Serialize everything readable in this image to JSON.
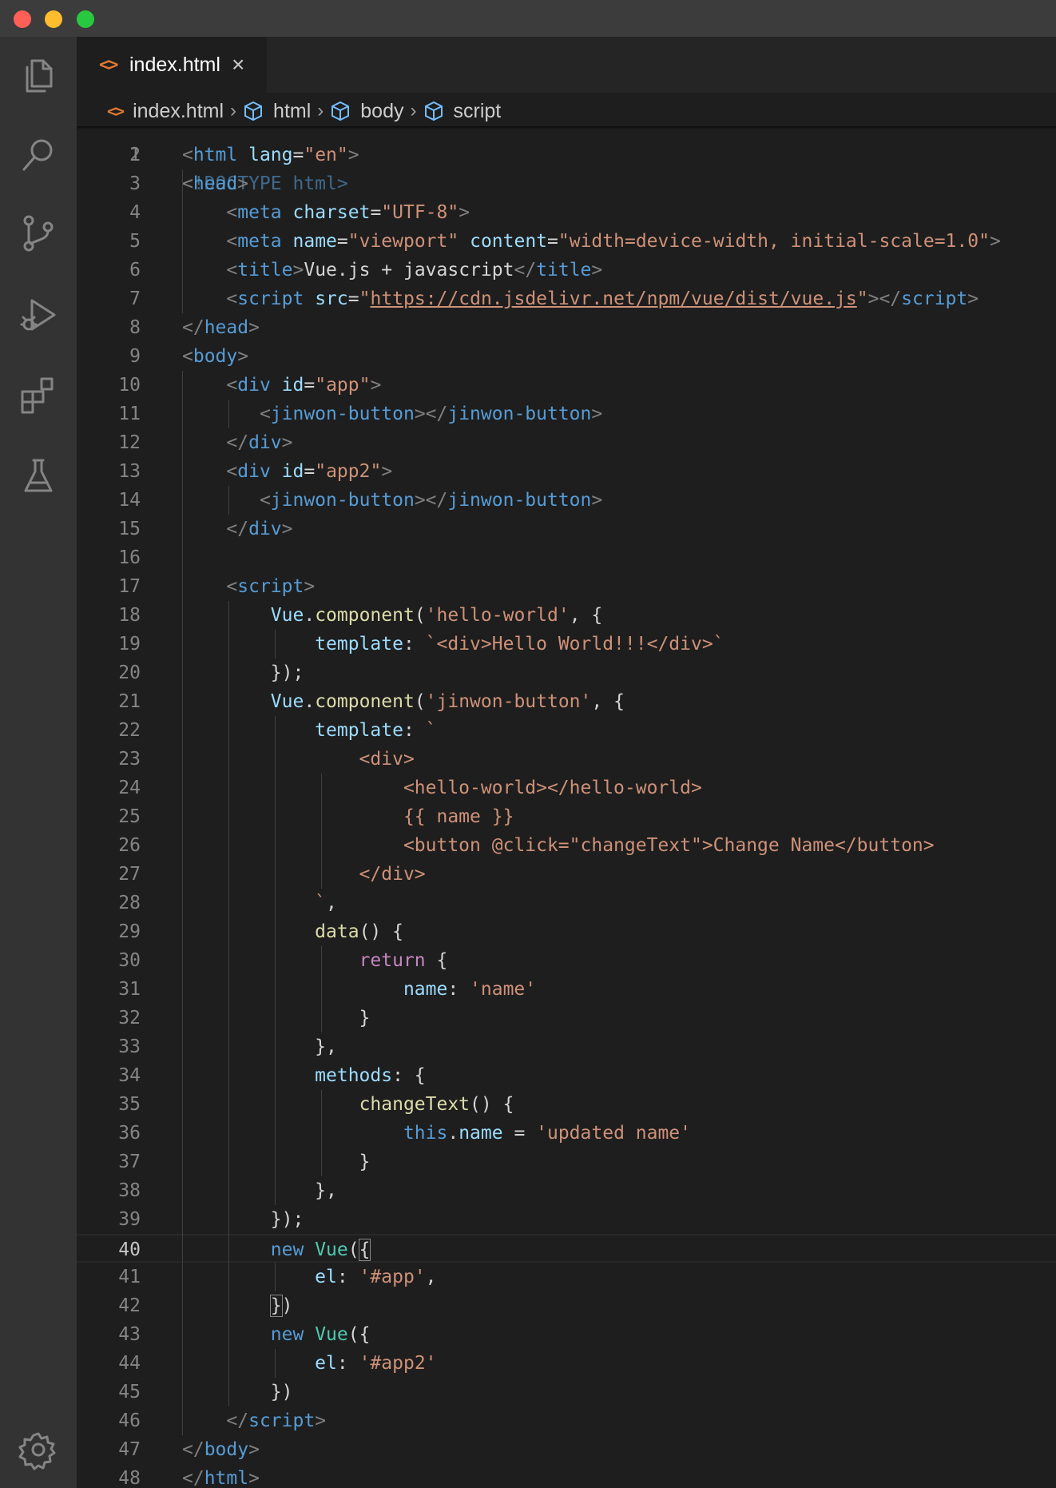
{
  "window": {
    "controls": [
      "close",
      "minimize",
      "zoom"
    ],
    "colors": {
      "close": "#fe5f57",
      "minimize": "#febc2e",
      "zoom": "#28c840"
    }
  },
  "activity_bar": {
    "items": [
      {
        "name": "explorer-icon"
      },
      {
        "name": "search-icon"
      },
      {
        "name": "source-control-icon"
      },
      {
        "name": "run-debug-icon"
      },
      {
        "name": "extensions-icon"
      },
      {
        "name": "testing-icon"
      }
    ],
    "bottom": {
      "name": "settings-gear-icon"
    }
  },
  "tab": {
    "label": "index.html",
    "icon": "<>",
    "close": "×"
  },
  "breadcrumb": {
    "file": "index.html",
    "file_icon": "<>",
    "items": [
      "html",
      "body",
      "script"
    ]
  },
  "editor": {
    "colors": {
      "background": "#1e1e1e",
      "tag": "#569cd6",
      "attribute": "#9cdcfe",
      "string": "#ce9178",
      "function": "#dcdcaa",
      "class": "#4ec9b0",
      "control": "#c586c0"
    },
    "current_line": "40",
    "partial_top_line": {
      "number": "1",
      "text": "<!DOCTYPE html>"
    },
    "lines": [
      {
        "n": "2",
        "tokens": [
          [
            "t-pun",
            "<"
          ],
          [
            "t-tag",
            "html"
          ],
          [
            "t-txt",
            " "
          ],
          [
            "t-attr",
            "lang"
          ],
          [
            "t-txt",
            "="
          ],
          [
            "t-str",
            "\"en\""
          ],
          [
            "t-pun",
            ">"
          ]
        ]
      },
      {
        "n": "3",
        "tokens": [
          [
            "t-pun",
            "<"
          ],
          [
            "t-tag",
            "head"
          ],
          [
            "t-pun",
            ">"
          ]
        ]
      },
      {
        "n": "4",
        "tokens": [
          [
            "t-txt",
            "    "
          ],
          [
            "t-pun",
            "<"
          ],
          [
            "t-tag",
            "meta"
          ],
          [
            "t-txt",
            " "
          ],
          [
            "t-attr",
            "charset"
          ],
          [
            "t-txt",
            "="
          ],
          [
            "t-str",
            "\"UTF-8\""
          ],
          [
            "t-pun",
            ">"
          ]
        ]
      },
      {
        "n": "5",
        "tokens": [
          [
            "t-txt",
            "    "
          ],
          [
            "t-pun",
            "<"
          ],
          [
            "t-tag",
            "meta"
          ],
          [
            "t-txt",
            " "
          ],
          [
            "t-attr",
            "name"
          ],
          [
            "t-txt",
            "="
          ],
          [
            "t-str",
            "\"viewport\""
          ],
          [
            "t-txt",
            " "
          ],
          [
            "t-attr",
            "content"
          ],
          [
            "t-txt",
            "="
          ],
          [
            "t-str",
            "\"width=device-width, initial-scale=1.0\""
          ],
          [
            "t-pun",
            ">"
          ]
        ]
      },
      {
        "n": "6",
        "tokens": [
          [
            "t-txt",
            "    "
          ],
          [
            "t-pun",
            "<"
          ],
          [
            "t-tag",
            "title"
          ],
          [
            "t-pun",
            ">"
          ],
          [
            "t-txt",
            "Vue.js + javascript"
          ],
          [
            "t-pun",
            "</"
          ],
          [
            "t-tag",
            "title"
          ],
          [
            "t-pun",
            ">"
          ]
        ]
      },
      {
        "n": "7",
        "tokens": [
          [
            "t-txt",
            "    "
          ],
          [
            "t-pun",
            "<"
          ],
          [
            "t-tag",
            "script"
          ],
          [
            "t-txt",
            " "
          ],
          [
            "t-attr",
            "src"
          ],
          [
            "t-txt",
            "="
          ],
          [
            "t-str",
            "\""
          ],
          [
            "t-url",
            "https://cdn.jsdelivr.net/npm/vue/dist/vue.js"
          ],
          [
            "t-str",
            "\""
          ],
          [
            "t-pun",
            "></"
          ],
          [
            "t-tag",
            "script"
          ],
          [
            "t-pun",
            ">"
          ]
        ]
      },
      {
        "n": "8",
        "tokens": [
          [
            "t-pun",
            "</"
          ],
          [
            "t-tag",
            "head"
          ],
          [
            "t-pun",
            ">"
          ]
        ]
      },
      {
        "n": "9",
        "tokens": [
          [
            "t-pun",
            "<"
          ],
          [
            "t-tag",
            "body"
          ],
          [
            "t-pun",
            ">"
          ]
        ]
      },
      {
        "n": "10",
        "tokens": [
          [
            "t-txt",
            "    "
          ],
          [
            "t-pun",
            "<"
          ],
          [
            "t-tag",
            "div"
          ],
          [
            "t-txt",
            " "
          ],
          [
            "t-attr",
            "id"
          ],
          [
            "t-txt",
            "="
          ],
          [
            "t-str",
            "\"app\""
          ],
          [
            "t-pun",
            ">"
          ]
        ]
      },
      {
        "n": "11",
        "tokens": [
          [
            "t-txt",
            "       "
          ],
          [
            "t-pun",
            "<"
          ],
          [
            "t-tag",
            "jinwon-button"
          ],
          [
            "t-pun",
            "></"
          ],
          [
            "t-tag",
            "jinwon-button"
          ],
          [
            "t-pun",
            ">"
          ]
        ]
      },
      {
        "n": "12",
        "tokens": [
          [
            "t-txt",
            "    "
          ],
          [
            "t-pun",
            "</"
          ],
          [
            "t-tag",
            "div"
          ],
          [
            "t-pun",
            ">"
          ]
        ]
      },
      {
        "n": "13",
        "tokens": [
          [
            "t-txt",
            "    "
          ],
          [
            "t-pun",
            "<"
          ],
          [
            "t-tag",
            "div"
          ],
          [
            "t-txt",
            " "
          ],
          [
            "t-attr",
            "id"
          ],
          [
            "t-txt",
            "="
          ],
          [
            "t-str",
            "\"app2\""
          ],
          [
            "t-pun",
            ">"
          ]
        ]
      },
      {
        "n": "14",
        "tokens": [
          [
            "t-txt",
            "       "
          ],
          [
            "t-pun",
            "<"
          ],
          [
            "t-tag",
            "jinwon-button"
          ],
          [
            "t-pun",
            "></"
          ],
          [
            "t-tag",
            "jinwon-button"
          ],
          [
            "t-pun",
            ">"
          ]
        ]
      },
      {
        "n": "15",
        "tokens": [
          [
            "t-txt",
            "    "
          ],
          [
            "t-pun",
            "</"
          ],
          [
            "t-tag",
            "div"
          ],
          [
            "t-pun",
            ">"
          ]
        ]
      },
      {
        "n": "16",
        "tokens": []
      },
      {
        "n": "17",
        "tokens": [
          [
            "t-txt",
            "    "
          ],
          [
            "t-pun",
            "<"
          ],
          [
            "t-tag",
            "script"
          ],
          [
            "t-pun",
            ">"
          ]
        ]
      },
      {
        "n": "18",
        "tokens": [
          [
            "t-txt",
            "        "
          ],
          [
            "t-prop",
            "Vue"
          ],
          [
            "t-txt",
            "."
          ],
          [
            "t-fn",
            "component"
          ],
          [
            "t-txt",
            "("
          ],
          [
            "t-str",
            "'hello-world'"
          ],
          [
            "t-txt",
            ", {"
          ]
        ]
      },
      {
        "n": "19",
        "tokens": [
          [
            "t-txt",
            "            "
          ],
          [
            "t-prop",
            "template"
          ],
          [
            "t-txt",
            ": "
          ],
          [
            "t-str",
            "`<div>Hello World!!!</div>`"
          ]
        ]
      },
      {
        "n": "20",
        "tokens": [
          [
            "t-txt",
            "        });"
          ]
        ]
      },
      {
        "n": "21",
        "tokens": [
          [
            "t-txt",
            "        "
          ],
          [
            "t-prop",
            "Vue"
          ],
          [
            "t-txt",
            "."
          ],
          [
            "t-fn",
            "component"
          ],
          [
            "t-txt",
            "("
          ],
          [
            "t-str",
            "'jinwon-button'"
          ],
          [
            "t-txt",
            ", {"
          ]
        ]
      },
      {
        "n": "22",
        "tokens": [
          [
            "t-txt",
            "            "
          ],
          [
            "t-prop",
            "template"
          ],
          [
            "t-txt",
            ": "
          ],
          [
            "t-str",
            "`"
          ]
        ]
      },
      {
        "n": "23",
        "tokens": [
          [
            "t-str",
            "                <div>"
          ]
        ]
      },
      {
        "n": "24",
        "tokens": [
          [
            "t-str",
            "                    <hello-world></hello-world>"
          ]
        ]
      },
      {
        "n": "25",
        "tokens": [
          [
            "t-str",
            "                    {{ name }}"
          ]
        ]
      },
      {
        "n": "26",
        "tokens": [
          [
            "t-str",
            "                    <button @click=\"changeText\">Change Name</button>"
          ]
        ]
      },
      {
        "n": "27",
        "tokens": [
          [
            "t-str",
            "                </div>"
          ]
        ]
      },
      {
        "n": "28",
        "tokens": [
          [
            "t-str",
            "            `"
          ],
          [
            "t-txt",
            ","
          ]
        ]
      },
      {
        "n": "29",
        "tokens": [
          [
            "t-txt",
            "            "
          ],
          [
            "t-fn",
            "data"
          ],
          [
            "t-txt",
            "() {"
          ]
        ]
      },
      {
        "n": "30",
        "tokens": [
          [
            "t-txt",
            "                "
          ],
          [
            "t-ctl",
            "return"
          ],
          [
            "t-txt",
            " {"
          ]
        ]
      },
      {
        "n": "31",
        "tokens": [
          [
            "t-txt",
            "                    "
          ],
          [
            "t-prop",
            "name"
          ],
          [
            "t-txt",
            ": "
          ],
          [
            "t-str",
            "'name'"
          ]
        ]
      },
      {
        "n": "32",
        "tokens": [
          [
            "t-txt",
            "                }"
          ]
        ]
      },
      {
        "n": "33",
        "tokens": [
          [
            "t-txt",
            "            },"
          ]
        ]
      },
      {
        "n": "34",
        "tokens": [
          [
            "t-txt",
            "            "
          ],
          [
            "t-prop",
            "methods"
          ],
          [
            "t-txt",
            ": {"
          ]
        ]
      },
      {
        "n": "35",
        "tokens": [
          [
            "t-txt",
            "                "
          ],
          [
            "t-fn",
            "changeText"
          ],
          [
            "t-txt",
            "() {"
          ]
        ]
      },
      {
        "n": "36",
        "tokens": [
          [
            "t-txt",
            "                    "
          ],
          [
            "t-kw",
            "this"
          ],
          [
            "t-txt",
            "."
          ],
          [
            "t-prop",
            "name"
          ],
          [
            "t-txt",
            " = "
          ],
          [
            "t-str",
            "'updated name'"
          ]
        ]
      },
      {
        "n": "37",
        "tokens": [
          [
            "t-txt",
            "                }"
          ]
        ]
      },
      {
        "n": "38",
        "tokens": [
          [
            "t-txt",
            "            },"
          ]
        ]
      },
      {
        "n": "39",
        "tokens": [
          [
            "t-txt",
            "        });"
          ]
        ]
      },
      {
        "n": "40",
        "tokens": [
          [
            "t-txt",
            "        "
          ],
          [
            "t-kw",
            "new"
          ],
          [
            "t-txt",
            " "
          ],
          [
            "t-cls",
            "Vue"
          ],
          [
            "t-txt",
            "("
          ],
          [
            "t-txt bracket-box",
            "{"
          ]
        ]
      },
      {
        "n": "41",
        "tokens": [
          [
            "t-txt",
            "            "
          ],
          [
            "t-prop",
            "el"
          ],
          [
            "t-txt",
            ": "
          ],
          [
            "t-str",
            "'#app'"
          ],
          [
            "t-txt",
            ","
          ]
        ]
      },
      {
        "n": "42",
        "tokens": [
          [
            "t-txt",
            "        "
          ],
          [
            "t-txt bracket-box",
            "}"
          ],
          [
            "t-txt",
            ")"
          ]
        ]
      },
      {
        "n": "43",
        "tokens": [
          [
            "t-txt",
            "        "
          ],
          [
            "t-kw",
            "new"
          ],
          [
            "t-txt",
            " "
          ],
          [
            "t-cls",
            "Vue"
          ],
          [
            "t-txt",
            "({"
          ]
        ]
      },
      {
        "n": "44",
        "tokens": [
          [
            "t-txt",
            "            "
          ],
          [
            "t-prop",
            "el"
          ],
          [
            "t-txt",
            ": "
          ],
          [
            "t-str",
            "'#app2'"
          ]
        ]
      },
      {
        "n": "45",
        "tokens": [
          [
            "t-txt",
            "        })"
          ]
        ]
      },
      {
        "n": "46",
        "tokens": [
          [
            "t-txt",
            "    "
          ],
          [
            "t-pun",
            "</"
          ],
          [
            "t-tag",
            "script"
          ],
          [
            "t-pun",
            ">"
          ]
        ]
      },
      {
        "n": "47",
        "tokens": [
          [
            "t-pun",
            "</"
          ],
          [
            "t-tag",
            "body"
          ],
          [
            "t-pun",
            ">"
          ]
        ]
      },
      {
        "n": "48",
        "tokens": [
          [
            "t-pun",
            "</"
          ],
          [
            "t-tag",
            "html"
          ],
          [
            "t-pun",
            ">"
          ]
        ]
      }
    ]
  }
}
